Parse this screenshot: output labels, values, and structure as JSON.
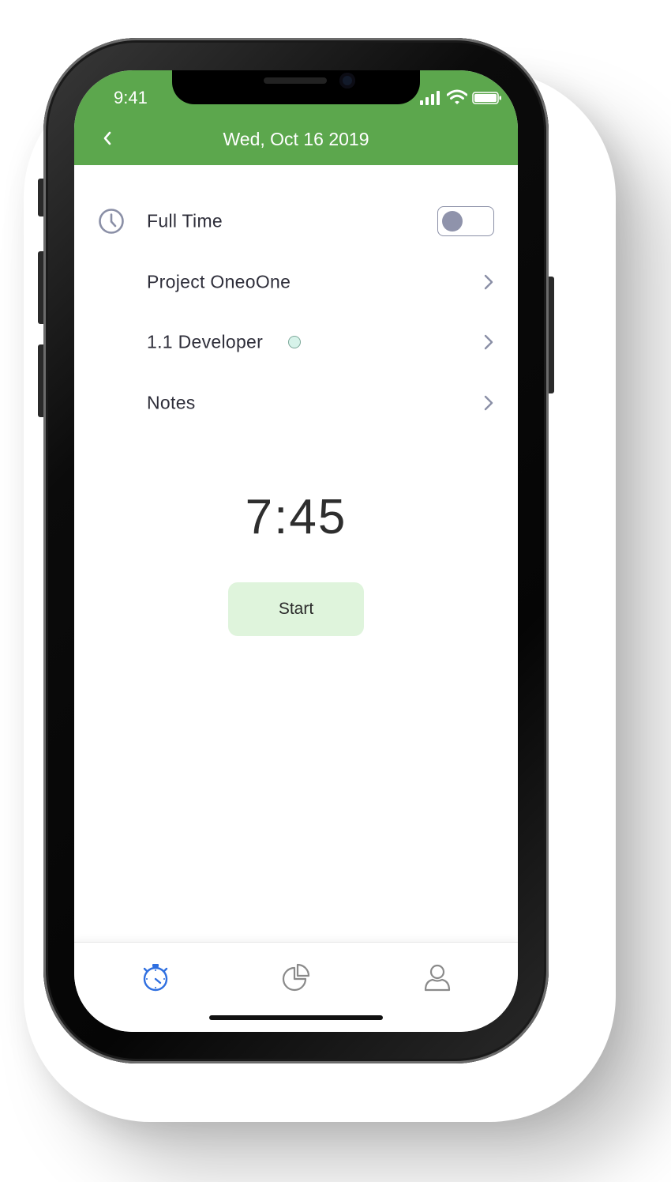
{
  "status_bar": {
    "time": "9:41",
    "icons": [
      "signal-icon",
      "wifi-icon",
      "battery-icon"
    ]
  },
  "header": {
    "title": "Wed, Oct 16 2019",
    "background_color": "#5ca74d",
    "back_icon": "chevron-left-icon"
  },
  "list": {
    "full_time": {
      "label": "Full Time",
      "icon": "clock-icon",
      "toggle_on": false
    },
    "project": {
      "label": "Project OneoOne"
    },
    "role": {
      "label": "1.1 Developer",
      "dot_color": "#d7f3ea"
    },
    "notes": {
      "label": "Notes"
    }
  },
  "timer": {
    "value": "7:45"
  },
  "start_button": {
    "label": "Start",
    "background_color": "#dff4dc"
  },
  "tabbar": {
    "tabs": [
      {
        "icon": "stopwatch-icon",
        "active": true,
        "color": "#2f6fe0"
      },
      {
        "icon": "pie-chart-icon",
        "active": false,
        "color": "#8a8a8a"
      },
      {
        "icon": "profile-icon",
        "active": false,
        "color": "#8a8a8a"
      }
    ]
  }
}
